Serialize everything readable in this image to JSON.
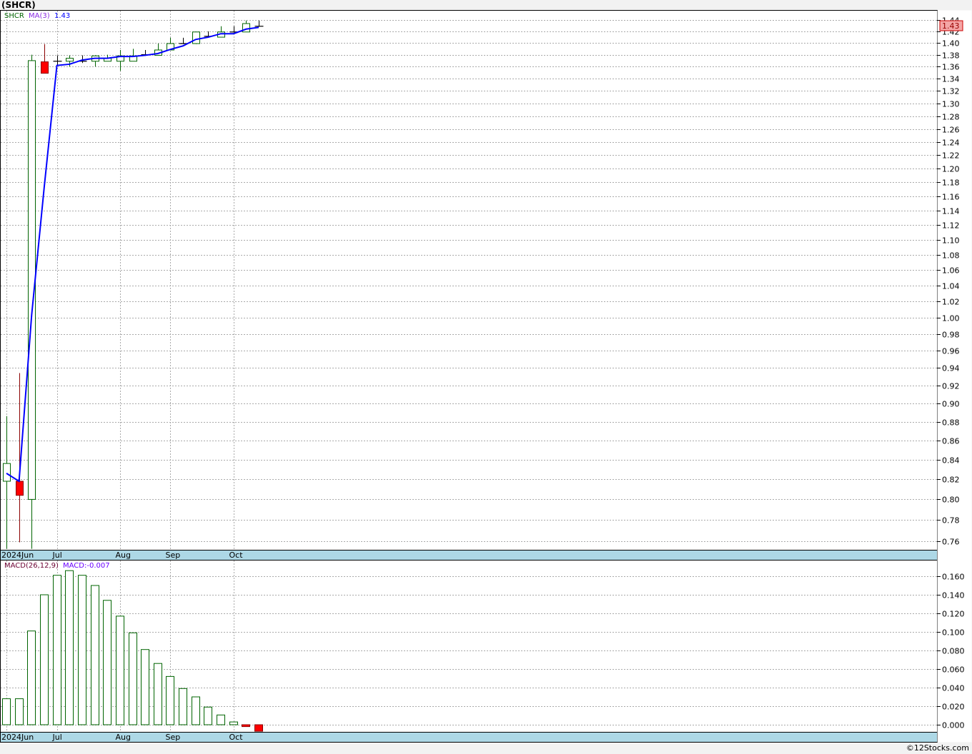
{
  "title": "(SHCR)",
  "footer": "©12Stocks.com",
  "legend": {
    "symbol": "SHCR",
    "ma_label": "MA(3)",
    "ma_value": "1.43"
  },
  "last_price_badge": "1.43",
  "macd_legend": {
    "label": "MACD(26,12,9)",
    "value": "MACD:-0.007"
  },
  "colors": {
    "up": "#006400",
    "down": "#ff0000",
    "doji": "#000000",
    "ma": "#0000ff",
    "axis_strip": "#add8e6",
    "badge": "#f4a6a6"
  },
  "chart_data": [
    {
      "type": "candlestick",
      "scale": "log",
      "ylim": [
        0.75,
        1.445
      ],
      "yticks": [
        "1.44",
        "1.42",
        "1.40",
        "1.38",
        "1.36",
        "1.34",
        "1.32",
        "1.30",
        "1.28",
        "1.26",
        "1.24",
        "1.22",
        "1.20",
        "1.18",
        "1.16",
        "1.14",
        "1.12",
        "1.10",
        "1.08",
        "1.06",
        "1.04",
        "1.02",
        "1.00",
        "0.98",
        "0.96",
        "0.94",
        "0.92",
        "0.90",
        "0.88",
        "0.86",
        "0.84",
        "0.82",
        "0.80",
        "0.78",
        "0.76"
      ],
      "xticks": [
        {
          "label": "2024Jun",
          "index": 0
        },
        {
          "label": "Jul",
          "index": 4
        },
        {
          "label": "Aug",
          "index": 9
        },
        {
          "label": "Sep",
          "index": 13
        },
        {
          "label": "Oct",
          "index": 18
        }
      ],
      "grid": true,
      "ohlc": [
        [
          0.818,
          0.886,
          0.753,
          0.836
        ],
        [
          0.818,
          0.934,
          0.759,
          0.804
        ],
        [
          0.8,
          1.38,
          0.753,
          1.37
        ],
        [
          1.368,
          1.398,
          1.349,
          1.349
        ],
        [
          1.369,
          1.379,
          1.362,
          1.369
        ],
        [
          1.369,
          1.379,
          1.36,
          1.374
        ],
        [
          1.369,
          1.379,
          1.366,
          1.369
        ],
        [
          1.369,
          1.379,
          1.36,
          1.378
        ],
        [
          1.369,
          1.38,
          1.369,
          1.374
        ],
        [
          1.369,
          1.388,
          1.353,
          1.378
        ],
        [
          1.369,
          1.39,
          1.369,
          1.378
        ],
        [
          1.38,
          1.388,
          1.378,
          1.38
        ],
        [
          1.379,
          1.399,
          1.379,
          1.388
        ],
        [
          1.388,
          1.409,
          1.388,
          1.399
        ],
        [
          1.399,
          1.409,
          1.398,
          1.399
        ],
        [
          1.399,
          1.419,
          1.398,
          1.419
        ],
        [
          1.4115,
          1.42,
          1.41,
          1.4115
        ],
        [
          1.41,
          1.429,
          1.41,
          1.419
        ],
        [
          1.419,
          1.429,
          1.418,
          1.419
        ],
        [
          1.419,
          1.439,
          1.419,
          1.4337
        ],
        [
          1.429,
          1.439,
          1.428,
          1.429
        ]
      ],
      "ma3": [
        0.826,
        0.818,
        1.003,
        1.174,
        1.362,
        1.364,
        1.371,
        1.374,
        1.374,
        1.377,
        1.377,
        1.379,
        1.382,
        1.389,
        1.395,
        1.406,
        1.41,
        1.416,
        1.416,
        1.424,
        1.427
      ]
    },
    {
      "type": "bar",
      "name": "MACD(26,12,9)",
      "ylim": [
        -0.008,
        0.172
      ],
      "yticks": [
        "0.160",
        "0.140",
        "0.120",
        "0.100",
        "0.080",
        "0.060",
        "0.040",
        "0.020",
        "0.000"
      ],
      "values": [
        0.028,
        0.028,
        0.101,
        0.14,
        0.161,
        0.166,
        0.161,
        0.15,
        0.134,
        0.117,
        0.099,
        0.081,
        0.066,
        0.052,
        0.039,
        0.03,
        0.019,
        0.0105,
        0.003,
        -0.002,
        -0.007
      ]
    }
  ]
}
